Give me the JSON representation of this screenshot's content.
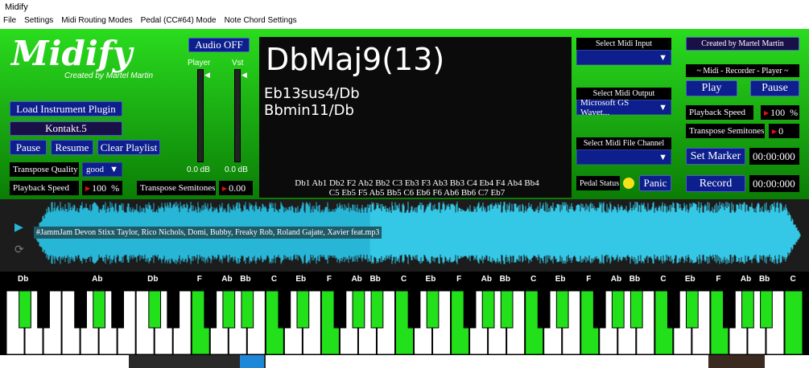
{
  "window": {
    "title": "Midify"
  },
  "menu": [
    "File",
    "Settings",
    "Midi Routing Modes",
    "Pedal (CC#64) Mode",
    "Note Chord Settings"
  ],
  "logo": {
    "title": "Midify",
    "subtitle": "Created by Martel Martin"
  },
  "left": {
    "load_plugin": "Load Instrument Plugin",
    "plugin_name": "Kontakt.5",
    "pause": "Pause",
    "resume": "Resume",
    "clear": "Clear Playlist",
    "transpose_quality_label": "Transpose Quality",
    "transpose_quality_value": "good",
    "playback_speed_label": "Playback Speed",
    "playback_speed_value": "100",
    "percent": "%",
    "transpose_semitones_label": "Transpose Semitones",
    "transpose_semitones_value": "0.00"
  },
  "audio": {
    "button": "Audio OFF",
    "player_label": "Player",
    "vst_label": "Vst",
    "player_db": "0.0 dB",
    "vst_db": "0.0 dB"
  },
  "chords": {
    "main": "DbMaj9(13)",
    "alt1": "Eb13sus4/Db",
    "alt2": "Bbmin11/Db",
    "notes_line1": "Db1  Ab1  Db2  F2  Ab2  Bb2  C3  Eb3  F3  Ab3  Bb3  C4  Eb4  F4  Ab4  Bb4",
    "notes_line2": "C5  Eb5  F5  Ab5  Bb5  C6  Eb6  F6  Ab6  Bb6  C7  Eb7"
  },
  "midi": {
    "select_input": "Select Midi Input",
    "input_value": "",
    "select_output": "Select Midi Output",
    "output_value": "Microsoft GS Wavet...",
    "select_channel": "Select Midi File Channel",
    "channel_value": "",
    "pedal_status": "Pedal Status",
    "panic": "Panic"
  },
  "recorder": {
    "credit": "Created by Martel Martin",
    "title": "~ Midi - Recorder - Player ~",
    "play": "Play",
    "pause": "Pause",
    "playback_speed_label": "Playback Speed",
    "playback_speed_value": "100",
    "percent": "%",
    "transpose_label": "Transpose Semitones",
    "transpose_value": "0",
    "set_marker": "Set Marker",
    "marker_time": "00:00:000",
    "record": "Record",
    "record_time": "00:00:000"
  },
  "waveform": {
    "track": "#JammJam Devon Stixx Taylor, Rico Nichols, Domi, Bubby, Freaky Rob, Roland Gajate, Xavier feat.mp3"
  },
  "keyboard": {
    "labels": [
      {
        "t": "Db"
      },
      {
        "t": "Ab"
      },
      {
        "t": "Db"
      },
      {
        "t": "F"
      },
      {
        "t": "Ab"
      },
      {
        "t": "Bb"
      },
      {
        "t": "C"
      },
      {
        "t": "Eb"
      },
      {
        "t": "F"
      },
      {
        "t": "Ab"
      },
      {
        "t": "Bb"
      },
      {
        "t": "C"
      },
      {
        "t": "Eb"
      },
      {
        "t": "F"
      },
      {
        "t": "Ab"
      },
      {
        "t": "Bb"
      },
      {
        "t": "C"
      },
      {
        "t": "Eb"
      },
      {
        "t": "F"
      },
      {
        "t": "Ab"
      },
      {
        "t": "Bb"
      },
      {
        "t": "C"
      },
      {
        "t": "Eb"
      },
      {
        "t": "F"
      },
      {
        "t": "Ab"
      },
      {
        "t": "Bb"
      },
      {
        "t": "C"
      },
      {
        "t": "Eb"
      }
    ],
    "active_note_names": [
      "Db1",
      "Ab1",
      "Db2",
      "F2",
      "Ab2",
      "Bb2",
      "C3",
      "Eb3",
      "F3",
      "Ab3",
      "Bb3",
      "C4",
      "Eb4",
      "F4",
      "Ab4",
      "Bb4",
      "C5",
      "Eb5",
      "F5",
      "Ab5",
      "Bb5",
      "C6",
      "Eb6",
      "F6",
      "Ab6",
      "Bb6",
      "C7",
      "Eb7"
    ]
  },
  "colors": {
    "accent_green": "#1fd51a",
    "button_blue": "#0c1f8c",
    "wave_blue": "#27b6d6",
    "active_key": "#22e01a"
  }
}
